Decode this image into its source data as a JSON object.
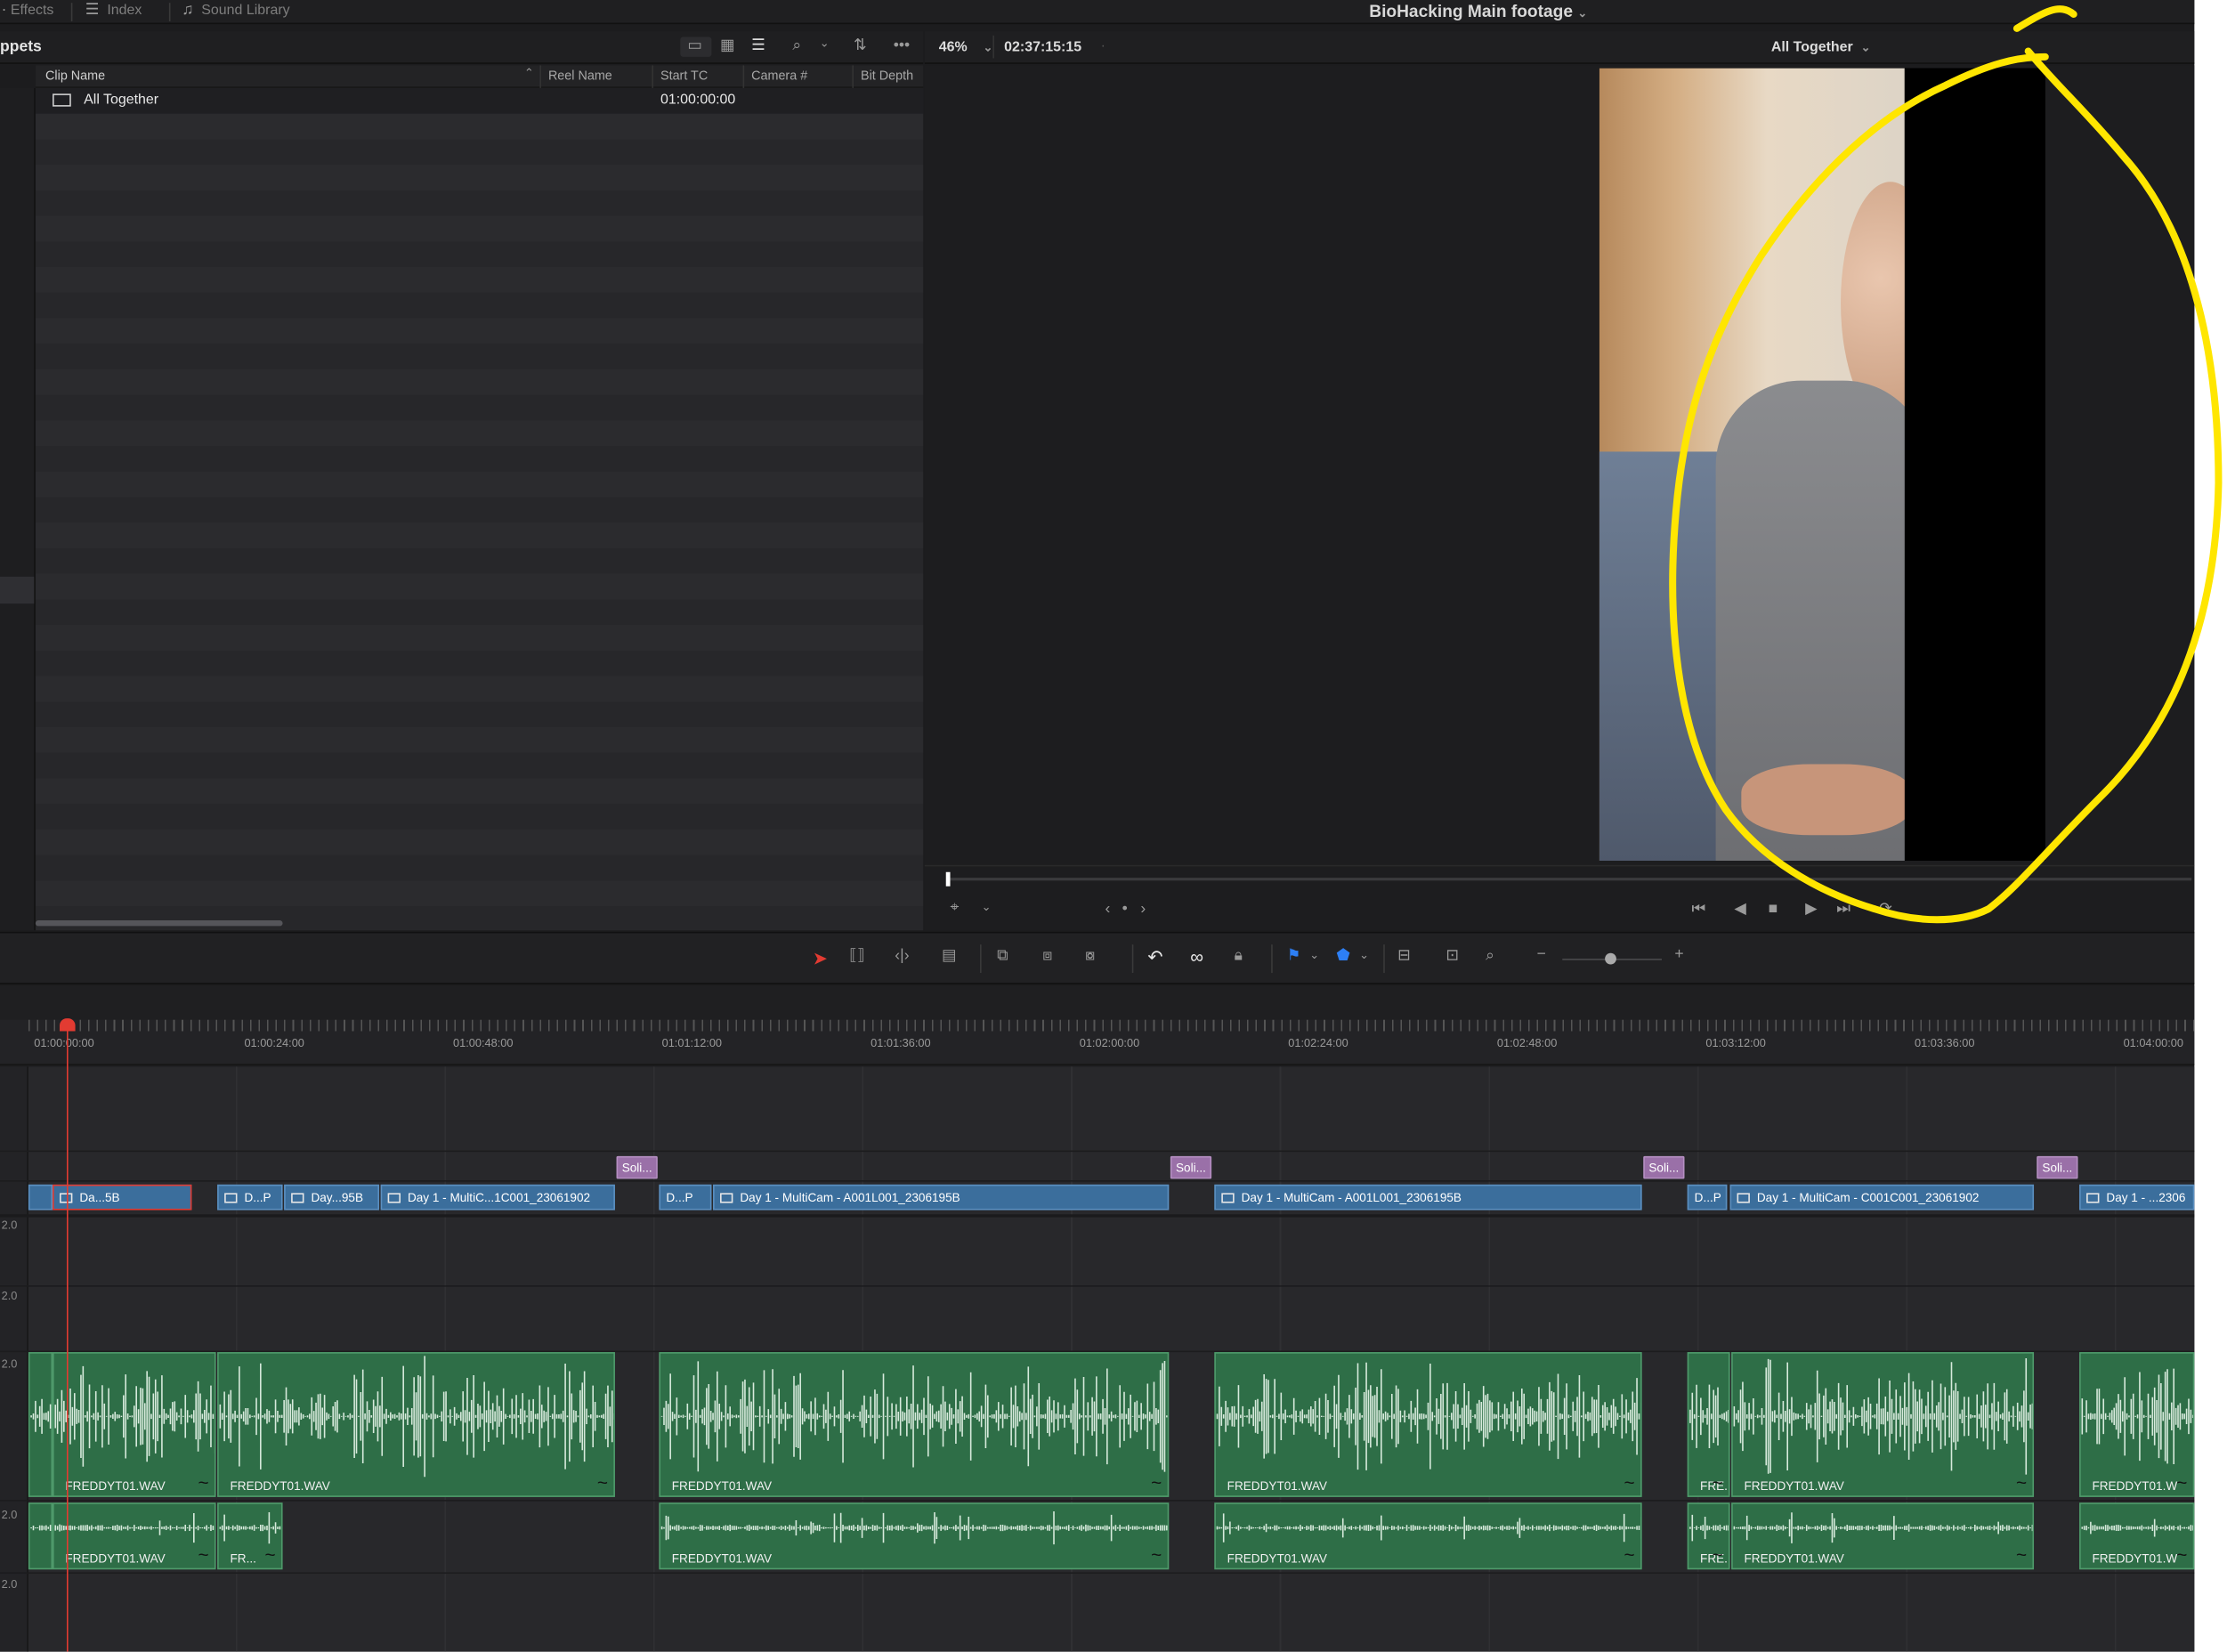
{
  "top_tabs": [
    {
      "label": "Effects",
      "icon": "effects-icon"
    },
    {
      "label": "Index",
      "icon": "index-icon"
    },
    {
      "label": "Sound Library",
      "icon": "sound-library-icon"
    }
  ],
  "timeline_name": "BioHacking Main footage",
  "media_pool": {
    "title": "ppets",
    "columns": [
      "Clip Name",
      "Reel Name",
      "Start TC",
      "Camera #",
      "Bit Depth"
    ],
    "rows": [
      {
        "clip_name": "All Together",
        "start_tc": "01:00:00:00"
      }
    ]
  },
  "viewer": {
    "zoom": "46%",
    "timecode": "02:37:15:15",
    "clip_name": "All Together"
  },
  "ruler_ticks": [
    "01:00:00:00",
    "01:00:24:00",
    "01:00:48:00",
    "01:01:12:00",
    "01:01:36:00",
    "01:02:00:00",
    "01:02:24:00",
    "01:02:48:00",
    "01:03:12:00",
    "01:03:36:00",
    "01:04:00:00"
  ],
  "track_levels": [
    "2.0",
    "2.0",
    "2.0",
    "2.0",
    "2.0"
  ],
  "transitions": [
    "Soli...",
    "Soli...",
    "Soli...",
    "Soli..."
  ],
  "video_clips": [
    "Da...5B",
    "D...P",
    "Day...95B",
    "Day 1 - MultiC...1C001_23061902",
    "D...P",
    "Day 1 - MultiCam - A001L001_2306195B",
    "Day 1 - MultiCam - A001L001_2306195B",
    "D...P",
    "Day 1 - MultiCam - C001C001_23061902",
    "Day 1 - ...2306"
  ],
  "audio_clips_a1": [
    "FREDDYT01.WAV",
    "FREDDYT01.WAV",
    "FREDDYT01.WAV",
    "FREDDYT01.WAV",
    "FRE...",
    "FREDDYT01.WAV",
    "FREDDYT01.W"
  ],
  "audio_clips_a2": [
    "FREDDYT01.WAV",
    "FR...",
    "FREDDYT01.WAV",
    "FREDDYT01.WAV",
    "FRE...",
    "FREDDYT01.WAV",
    "FREDDYT01.W"
  ],
  "colors": {
    "accent_blue": "#3b6e9c",
    "audio_green": "#2e6e47",
    "transition_purple": "#9a70a8",
    "playhead": "#e23b32",
    "annotation_yellow": "#ffe600"
  }
}
